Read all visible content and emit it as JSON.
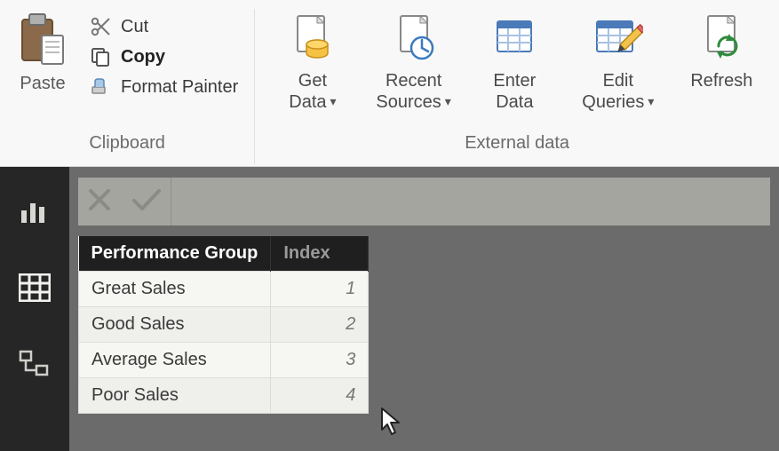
{
  "ribbon": {
    "clipboard": {
      "group_label": "Clipboard",
      "paste": "Paste",
      "cut": "Cut",
      "copy": "Copy",
      "format_painter": "Format Painter"
    },
    "external": {
      "group_label": "External data",
      "get_data_l1": "Get",
      "get_data_l2": "Data",
      "recent_l1": "Recent",
      "recent_l2": "Sources",
      "enter_l1": "Enter",
      "enter_l2": "Data",
      "edit_l1": "Edit",
      "edit_l2": "Queries",
      "refresh": "Refresh"
    },
    "dropdown_glyph": "▾"
  },
  "formula_bar": {
    "value": ""
  },
  "table": {
    "columns": [
      "Performance Group",
      "Index"
    ],
    "rows": [
      {
        "group": "Great Sales",
        "index": "1"
      },
      {
        "group": "Good Sales",
        "index": "2"
      },
      {
        "group": "Average Sales",
        "index": "3"
      },
      {
        "group": "Poor Sales",
        "index": "4"
      }
    ]
  }
}
